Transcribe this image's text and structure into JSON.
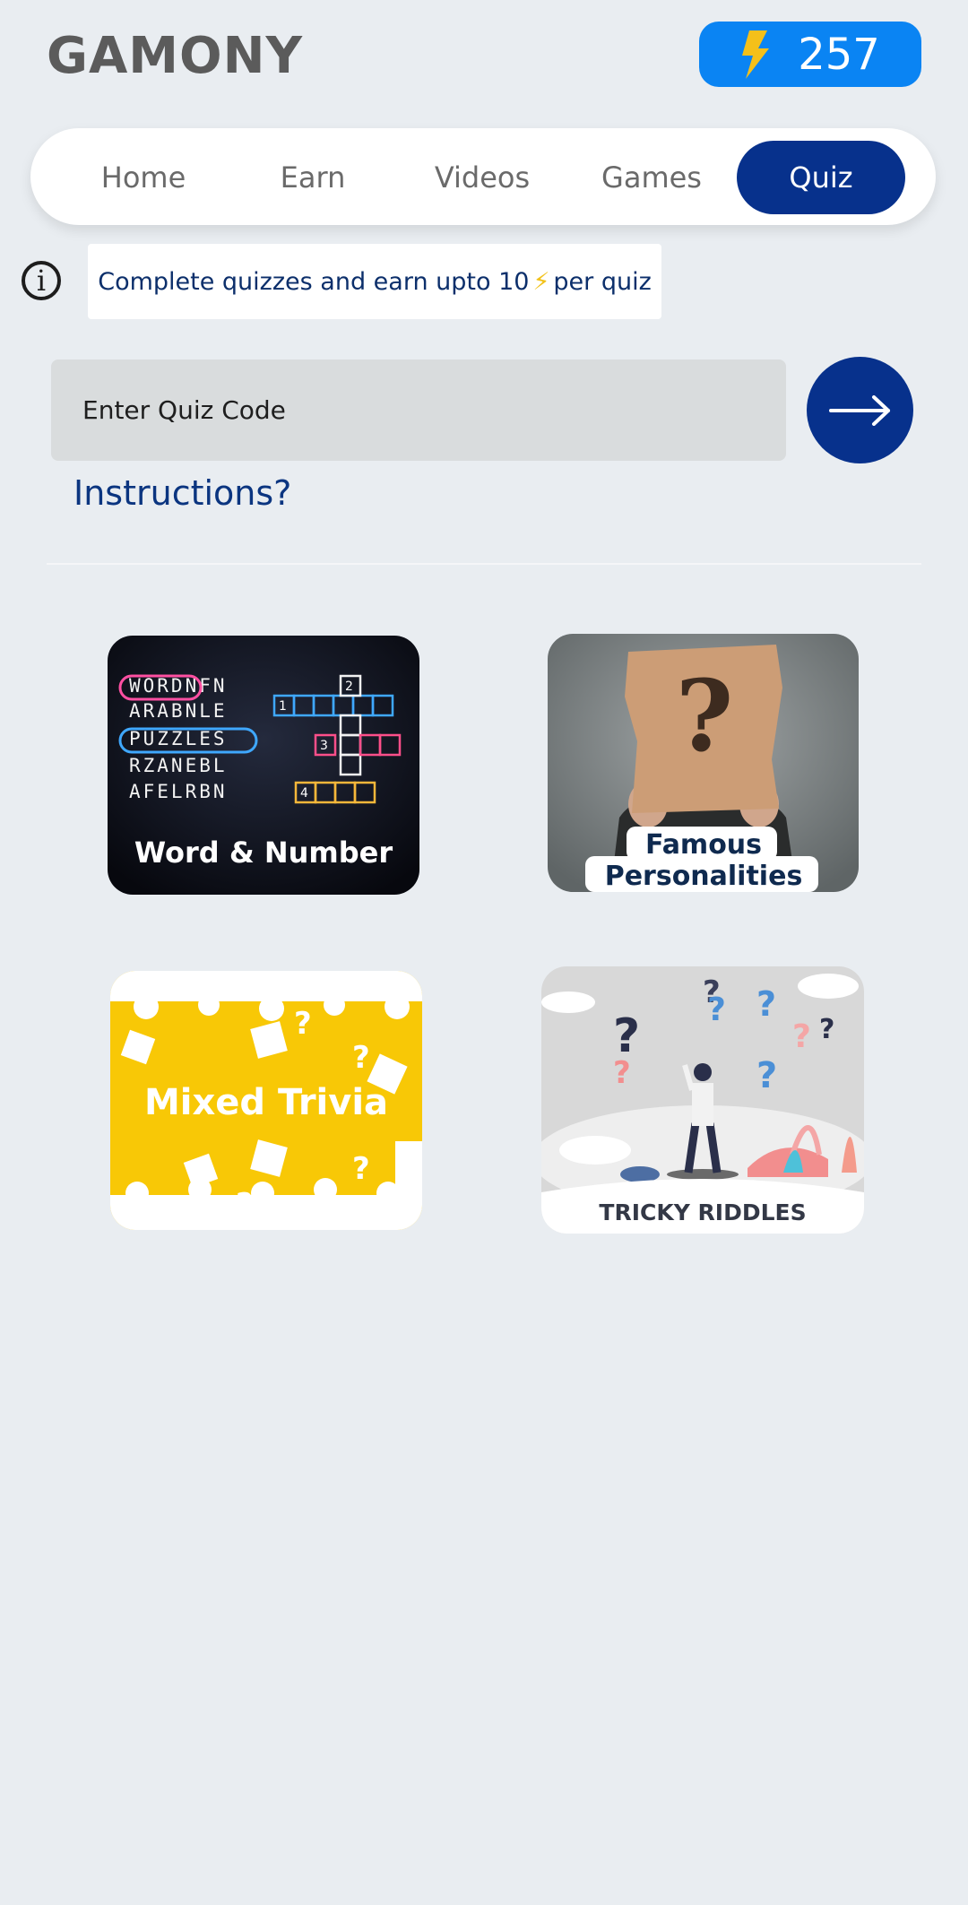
{
  "app": {
    "title": "GAMONY"
  },
  "coins": {
    "icon": "lightning-icon",
    "count": "257"
  },
  "nav": {
    "tabs": [
      {
        "label": "Home",
        "active": false
      },
      {
        "label": "Earn",
        "active": false
      },
      {
        "label": "Videos",
        "active": false
      },
      {
        "label": "Games",
        "active": false
      },
      {
        "label": "Quiz",
        "active": true
      }
    ]
  },
  "info": {
    "icon": "info-icon",
    "text_before": "Complete quizzes and earn upto 10",
    "bolt": "⚡",
    "text_after": "per quiz"
  },
  "quiz_code": {
    "placeholder": "Enter Quiz Code",
    "value": "",
    "submit_icon": "arrow-right-icon"
  },
  "instructions_link": "Instructions?",
  "categories": [
    {
      "title": "Word & Number",
      "puzzle_rows": [
        "WORDNFN",
        "ARABNLE",
        "PUZZLES",
        "RZANEBL",
        "AFELRBN"
      ],
      "grid_numbers": [
        "1",
        "2",
        "3",
        "4"
      ]
    },
    {
      "title_line1": "Famous",
      "title_line2": "Personalities",
      "symbol": "?"
    },
    {
      "title": "Mixed Trivia",
      "symbol": "?"
    },
    {
      "title": "TRICKY RIDDLES",
      "symbol": "?"
    }
  ],
  "colors": {
    "background": "#e9edf1",
    "primary": "#07318c",
    "badge": "#0a84f3",
    "accent_yellow": "#f2c21b"
  }
}
